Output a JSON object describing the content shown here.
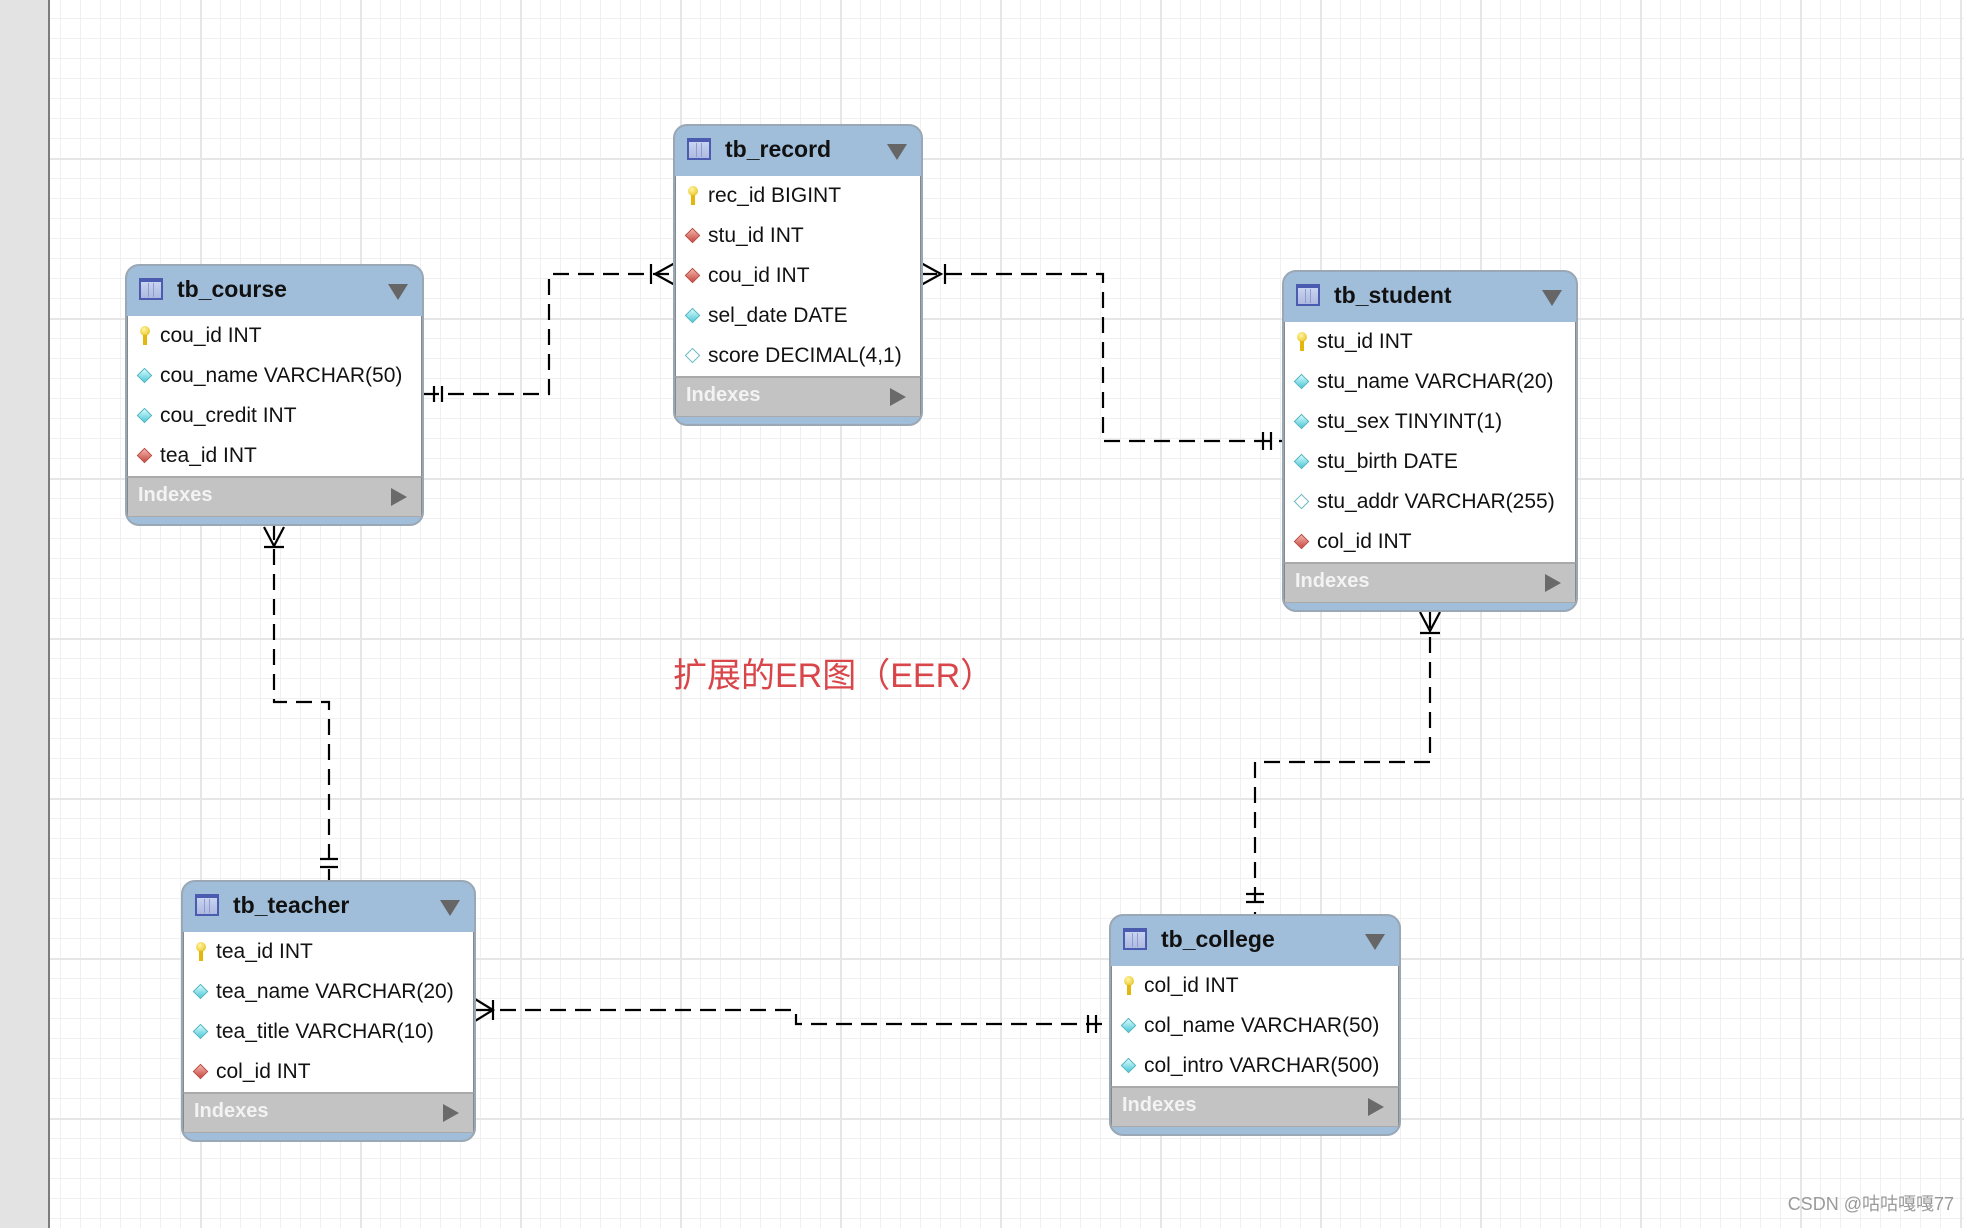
{
  "diagram": {
    "caption": "扩展的ER图（EER）",
    "watermark": "CSDN @咕咕嘎嘎77",
    "colors": {
      "table_header": "#a0bdd9",
      "indexes_bar": "#c3c3c3",
      "caption": "#d9464a",
      "connector": "#000000"
    },
    "indexes_label": "Indexes",
    "legend_icons": {
      "pk": "key-icon",
      "fk": "red-diamond-icon",
      "nn": "filled-cyan-diamond-icon",
      "nl": "hollow-diamond-icon"
    },
    "tables": [
      {
        "id": "tb_record",
        "name": "tb_record",
        "columns": [
          {
            "text": "rec_id BIGINT",
            "kind": "pk"
          },
          {
            "text": "stu_id INT",
            "kind": "fk"
          },
          {
            "text": "cou_id INT",
            "kind": "fk"
          },
          {
            "text": "sel_date DATE",
            "kind": "nn"
          },
          {
            "text": "score DECIMAL(4,1)",
            "kind": "nl"
          }
        ]
      },
      {
        "id": "tb_course",
        "name": "tb_course",
        "columns": [
          {
            "text": "cou_id INT",
            "kind": "pk"
          },
          {
            "text": "cou_name VARCHAR(50)",
            "kind": "nn"
          },
          {
            "text": "cou_credit INT",
            "kind": "nn"
          },
          {
            "text": "tea_id INT",
            "kind": "fk"
          }
        ]
      },
      {
        "id": "tb_student",
        "name": "tb_student",
        "columns": [
          {
            "text": "stu_id INT",
            "kind": "pk"
          },
          {
            "text": "stu_name VARCHAR(20)",
            "kind": "nn"
          },
          {
            "text": "stu_sex TINYINT(1)",
            "kind": "nn"
          },
          {
            "text": "stu_birth DATE",
            "kind": "nn"
          },
          {
            "text": "stu_addr VARCHAR(255)",
            "kind": "nl"
          },
          {
            "text": "col_id INT",
            "kind": "fk"
          }
        ]
      },
      {
        "id": "tb_teacher",
        "name": "tb_teacher",
        "columns": [
          {
            "text": "tea_id INT",
            "kind": "pk"
          },
          {
            "text": "tea_name VARCHAR(20)",
            "kind": "nn"
          },
          {
            "text": "tea_title VARCHAR(10)",
            "kind": "nn"
          },
          {
            "text": "col_id INT",
            "kind": "fk"
          }
        ]
      },
      {
        "id": "tb_college",
        "name": "tb_college",
        "columns": [
          {
            "text": "col_id INT",
            "kind": "pk"
          },
          {
            "text": "col_name VARCHAR(50)",
            "kind": "nn"
          },
          {
            "text": "col_intro VARCHAR(500)",
            "kind": "nn"
          }
        ]
      }
    ],
    "relationships": [
      {
        "from": "tb_course",
        "to": "tb_record",
        "from_end": "one-and-only-one",
        "to_end": "one-or-many",
        "style": "dashed"
      },
      {
        "from": "tb_student",
        "to": "tb_record",
        "from_end": "one-and-only-one",
        "to_end": "one-or-many",
        "style": "dashed"
      },
      {
        "from": "tb_teacher",
        "to": "tb_course",
        "from_end": "one-and-only-one",
        "to_end": "one-or-many",
        "style": "dashed"
      },
      {
        "from": "tb_college",
        "to": "tb_teacher",
        "from_end": "one-and-only-one",
        "to_end": "one-or-many",
        "style": "dashed"
      },
      {
        "from": "tb_college",
        "to": "tb_student",
        "from_end": "one-and-only-one",
        "to_end": "one-or-many",
        "style": "dashed"
      }
    ]
  }
}
